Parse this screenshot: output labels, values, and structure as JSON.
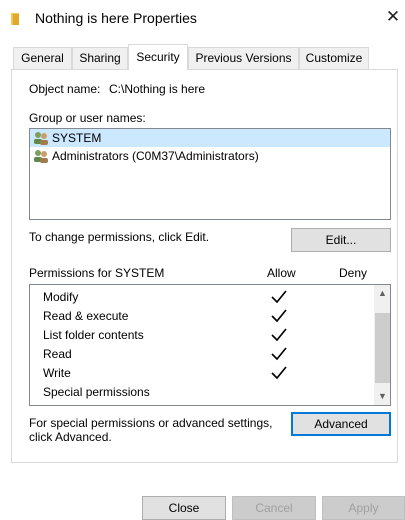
{
  "window": {
    "title": "Nothing is here Properties",
    "close_glyph": "✕"
  },
  "tabs": [
    {
      "label": "General",
      "active": false
    },
    {
      "label": "Sharing",
      "active": false
    },
    {
      "label": "Security",
      "active": true
    },
    {
      "label": "Previous Versions",
      "active": false
    },
    {
      "label": "Customize",
      "active": false
    }
  ],
  "security": {
    "object_name_label": "Object name:",
    "object_name_value": "C:\\Nothing is here",
    "group_label": "Group or user names:",
    "groups": [
      {
        "name": "SYSTEM",
        "selected": true
      },
      {
        "name": "Administrators (C0M37\\Administrators)",
        "selected": false
      }
    ],
    "change_hint": "To change permissions, click Edit.",
    "edit_button": "Edit...",
    "permissions_for": "Permissions for SYSTEM",
    "allow_header": "Allow",
    "deny_header": "Deny",
    "permissions": [
      {
        "name": "Modify",
        "allow": true,
        "deny": false
      },
      {
        "name": "Read & execute",
        "allow": true,
        "deny": false
      },
      {
        "name": "List folder contents",
        "allow": true,
        "deny": false
      },
      {
        "name": "Read",
        "allow": true,
        "deny": false
      },
      {
        "name": "Write",
        "allow": true,
        "deny": false
      },
      {
        "name": "Special permissions",
        "allow": false,
        "deny": false
      }
    ],
    "advanced_hint_line1": "For special permissions or advanced settings,",
    "advanced_hint_line2": "click Advanced.",
    "advanced_button": "Advanced"
  },
  "footer": {
    "close_button": "Close",
    "cancel_button": "Cancel",
    "apply_button": "Apply"
  },
  "colors": {
    "selected_row": "#cce8ff",
    "default_button_border": "#0078d7",
    "folder_icon": "#f3c94f"
  },
  "icons": {
    "folder": "folder-icon",
    "user_group": "user-group-icon",
    "check": "checkmark-icon",
    "scroll_up": "chevron-up-icon",
    "scroll_down": "chevron-down-icon"
  }
}
